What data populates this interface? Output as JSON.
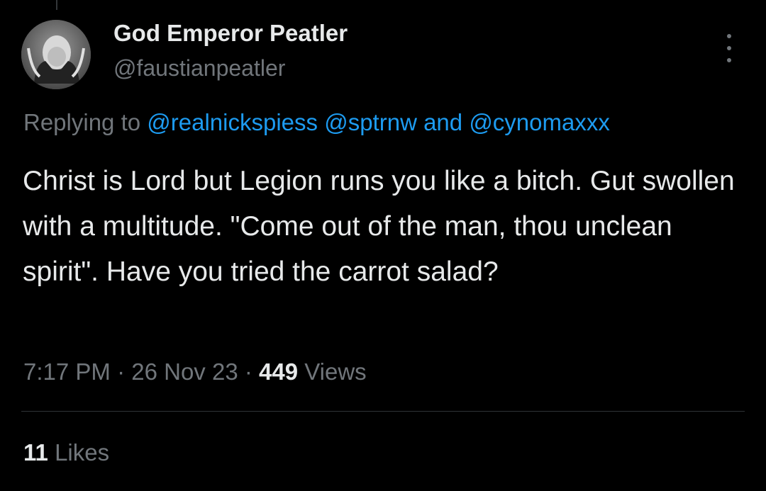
{
  "tweet": {
    "display_name": "God Emperor Peatler",
    "handle": "@faustianpeatler",
    "avatar_icon": "profile-photo",
    "menu_icon": "more-vertical-icon",
    "replying_prefix": "Replying to",
    "mentions": [
      "@realnickspiess",
      "@sptrnw",
      "@cynomaxxx"
    ],
    "mention_joiner": " and ",
    "text": "Christ is Lord but Legion runs you like a bitch. Gut swollen with a multitude. \"Come out of the man, thou unclean spirit\". Have you tried the carrot salad?",
    "time": "7:17 PM",
    "date": "26 Nov 23",
    "separator": " · ",
    "views_count": "449",
    "views_label": "Views",
    "likes_count": "11",
    "likes_label": "Likes"
  },
  "colors": {
    "background": "#000000",
    "text": "#e7e9ea",
    "muted": "#71767b",
    "link": "#1d9bf0",
    "divider": "#2f3336"
  }
}
